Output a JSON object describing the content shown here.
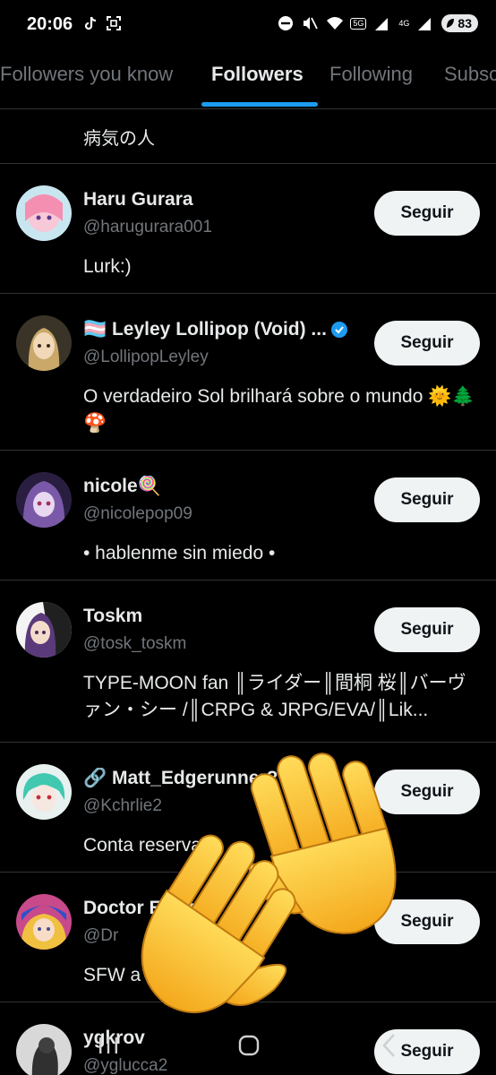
{
  "status_bar": {
    "time": "20:06",
    "net_5g": "5G",
    "net_4g": "4G",
    "battery": "83"
  },
  "tabs": [
    {
      "label": "Followers you know"
    },
    {
      "label": "Followers"
    },
    {
      "label": "Following"
    },
    {
      "label": "Subsc"
    }
  ],
  "previous_bio": "病気の人",
  "follow_label": "Seguir",
  "users": [
    {
      "name": "Haru Gurara",
      "handle": "@harugurara001",
      "bio": "Lurk:)"
    },
    {
      "name": "🏳️‍⚧️ Leyley Lollipop (Void) ...",
      "handle": "@LollipopLeyley",
      "bio": "O verdadeiro Sol brilhará sobre o mundo 🌞🌲🍄"
    },
    {
      "name": "nicole🍭",
      "handle": "@nicolepop09",
      "bio": "• hablenme sin miedo •"
    },
    {
      "name": "Toskm",
      "handle": "@tosk_toskm",
      "bio": "TYPE-MOON fan ║ライダー║間桐 桜║バーヴァン・シー /║CRPG & JRPG/EVA/║Lik..."
    },
    {
      "name": "🔗 Matt_Edgerunner?",
      "handle": "@Kchrlie2",
      "bio": "Conta reserva!"
    },
    {
      "name": "Doctor Elliate",
      "handle": "@Dr",
      "bio": "SFW a              st"
    },
    {
      "name": "ygkrov",
      "handle": "@yglucca2",
      "bio": ""
    }
  ],
  "icons": {
    "tiktok": "tiktok-icon",
    "scan": "scan-icon",
    "dnd": "do-not-disturb-icon",
    "mute": "mute-icon",
    "wifi": "wifi-icon",
    "signal": "signal-icon",
    "verified": "verified-badge-icon",
    "hands": "waving-hands-emoji"
  },
  "colors": {
    "accent": "#1d9bf0",
    "background": "#000000",
    "muted_text": "#71767b",
    "button_bg": "#eff3f4"
  }
}
